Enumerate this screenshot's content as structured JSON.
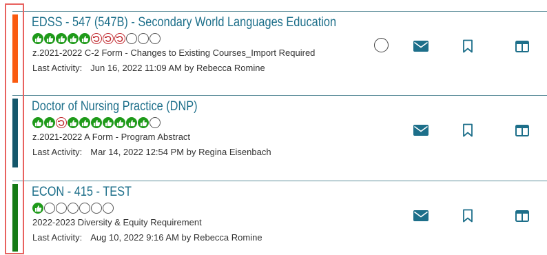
{
  "colors": {
    "title": "#1d6f8a",
    "approved": "#1f9a1a",
    "returned": "#c0262c",
    "icon": "#1d6f8a",
    "divider": "#5f8f9c"
  },
  "proposals": [
    {
      "title": "EDSS - 547 (547B) - Secondary World Languages Education",
      "stripe_color": "#fa5a0f",
      "steps": [
        "approved",
        "approved",
        "approved",
        "approved",
        "approved",
        "returned",
        "returned",
        "returned",
        "pending",
        "pending",
        "pending"
      ],
      "form": "z.2021-2022 C-2 Form - Changes to Existing Courses_Import Required",
      "activity_label": "Last Activity:",
      "activity_text": "Jun 16, 2022 11:09 AM by Rebecca Romine",
      "has_select": true
    },
    {
      "title": "Doctor of Nursing Practice (DNP)",
      "stripe_color": "#15576b",
      "steps": [
        "approved",
        "approved",
        "returned",
        "approved",
        "approved",
        "approved",
        "approved",
        "approved",
        "approved",
        "approved",
        "pending"
      ],
      "form": "z.2021-2022 A Form - Program Abstract",
      "activity_label": "Last Activity:",
      "activity_text": "Mar 14, 2022 12:54 PM by Regina Eisenbach",
      "has_select": false
    },
    {
      "title": "ECON - 415 - TEST",
      "stripe_color": "#157a15",
      "steps": [
        "approved",
        "pending",
        "pending",
        "pending",
        "pending",
        "pending",
        "pending"
      ],
      "form": "2022-2023 Diversity & Equity Requirement",
      "activity_label": "Last Activity:",
      "activity_text": "Aug 10, 2022 9:16 AM by Rebecca Romine",
      "has_select": false
    }
  ],
  "icons": {
    "approved": "thumbs-up-icon",
    "returned": "undo-arrow-icon",
    "pending": "empty-circle-icon",
    "mail": "envelope-icon",
    "bookmark": "bookmark-icon",
    "panel": "columns-panel-icon"
  }
}
